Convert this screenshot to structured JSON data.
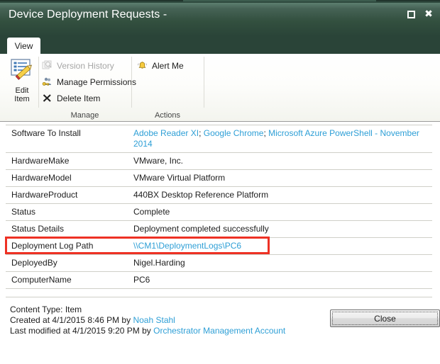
{
  "window": {
    "title": "Device Deployment Requests -",
    "controls": [
      {
        "name": "restore",
        "label": "Restore"
      },
      {
        "name": "close",
        "label": "Close"
      }
    ]
  },
  "ribbon": {
    "tabs": [
      {
        "id": "view",
        "label": "View",
        "active": true
      }
    ],
    "big_button": {
      "icon": "edit-item-icon",
      "label_line1": "Edit",
      "label_line2": "Item"
    },
    "groups": [
      {
        "id": "manage",
        "label": "Manage",
        "items": [
          {
            "icon": "version-history-icon",
            "label": "Version History",
            "disabled": true
          },
          {
            "icon": "manage-permissions-icon",
            "label": "Manage Permissions",
            "disabled": false
          },
          {
            "icon": "delete-item-icon",
            "label": "Delete Item",
            "disabled": false
          }
        ]
      },
      {
        "id": "actions",
        "label": "Actions",
        "items": [
          {
            "icon": "alert-me-icon",
            "label": "Alert Me",
            "disabled": false
          }
        ]
      }
    ]
  },
  "fields": [
    {
      "name": "Software To Install",
      "value_parts": [
        {
          "text": "Adobe Reader XI",
          "link": true
        },
        {
          "text": "; ",
          "link": false
        },
        {
          "text": "Google Chrome",
          "link": true
        },
        {
          "text": "; ",
          "link": false
        },
        {
          "text": "Microsoft Azure PowerShell - November 2014",
          "link": true
        }
      ]
    },
    {
      "name": "HardwareMake",
      "value_parts": [
        {
          "text": "VMware, Inc.",
          "link": false
        }
      ]
    },
    {
      "name": "HardwareModel",
      "value_parts": [
        {
          "text": "VMware Virtual Platform",
          "link": false
        }
      ]
    },
    {
      "name": "HardwareProduct",
      "value_parts": [
        {
          "text": "440BX Desktop Reference Platform",
          "link": false
        }
      ]
    },
    {
      "name": "Status",
      "value_parts": [
        {
          "text": "Complete",
          "link": false
        }
      ]
    },
    {
      "name": "Status Details",
      "value_parts": [
        {
          "text": "Deployment completed successfully",
          "link": false
        }
      ]
    },
    {
      "name": "Deployment Log Path",
      "highlighted": true,
      "value_parts": [
        {
          "text": "\\\\CM1\\DeploymentLogs\\PC6",
          "link": true
        }
      ]
    },
    {
      "name": "DeployedBy",
      "value_parts": [
        {
          "text": "Nigel.Harding",
          "link": false
        }
      ]
    },
    {
      "name": "ComputerName",
      "value_parts": [
        {
          "text": "PC6",
          "link": false
        }
      ]
    }
  ],
  "footer": {
    "content_type": "Content Type: Item",
    "created": {
      "prefix": "Created at 4/1/2015 8:46 PM by ",
      "user": "Noah Stahl"
    },
    "modified": {
      "prefix": "Last modified at 4/1/2015 9:20 PM by ",
      "user": "Orchestrator Management Account"
    },
    "close_label": "Close"
  },
  "colors": {
    "titlebar_dark": "#2a4438",
    "titlebar_light": "#5d7f70",
    "link": "#2e9fd6",
    "annotation": "#ee3124",
    "row_divider": "#cfcfc8"
  }
}
